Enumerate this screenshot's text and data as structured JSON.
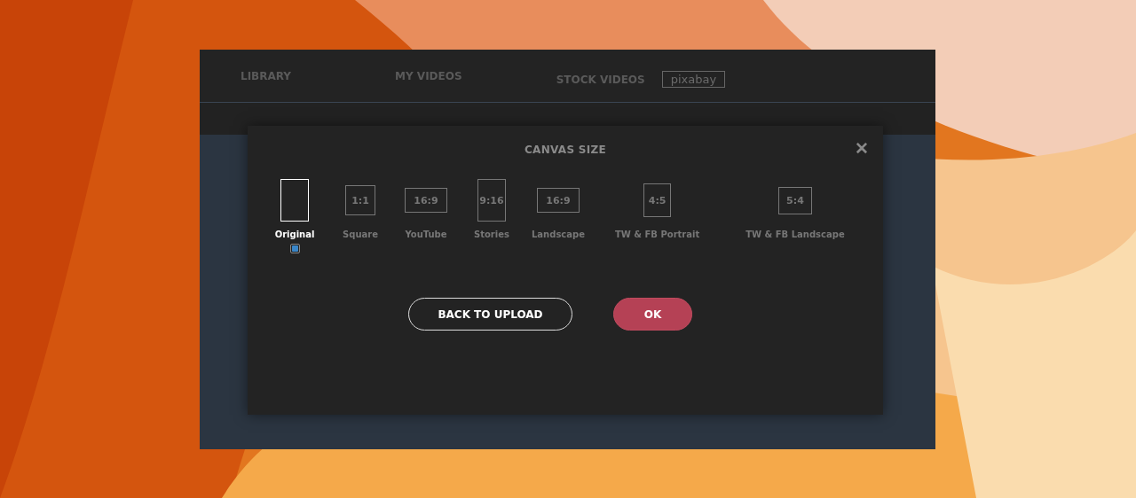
{
  "tabs": [
    {
      "label": "LIBRARY"
    },
    {
      "label": "MY VIDEOS"
    },
    {
      "label": "STOCK VIDEOS",
      "badge": "pixabay"
    }
  ],
  "dialog": {
    "title": "CANVAS SIZE",
    "close": "✕",
    "options": [
      {
        "kind": "tall",
        "label": "Original",
        "selected": true
      },
      {
        "kind": "square",
        "ratio": "1:1",
        "label": "Square",
        "selected": false
      },
      {
        "kind": "wide",
        "ratio": "16:9",
        "label": "YouTube",
        "selected": false
      },
      {
        "kind": "tall",
        "ratio": "9:16",
        "label": "Stories",
        "selected": false
      },
      {
        "kind": "wide",
        "ratio": "16:9",
        "label": "Landscape",
        "selected": false
      },
      {
        "kind": "portrait",
        "ratio": "4:5",
        "label": "TW & FB Portrait",
        "selected": false
      },
      {
        "kind": "landscape",
        "ratio": "5:4",
        "label": "TW & FB Landscape",
        "selected": false
      }
    ],
    "buttons": [
      {
        "kind": "outline",
        "label": "BACK TO UPLOAD"
      },
      {
        "kind": "primary",
        "label": "OK"
      }
    ]
  }
}
